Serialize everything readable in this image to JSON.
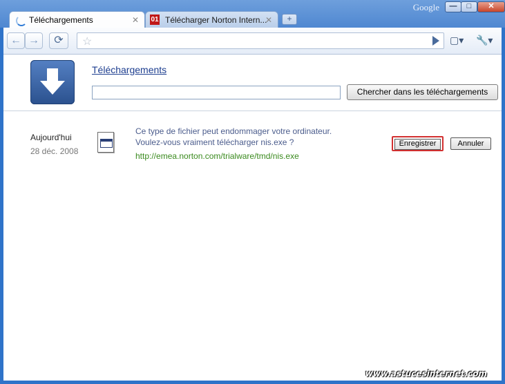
{
  "titlebar": {
    "brand": "Google"
  },
  "window_controls": {
    "minimize": "—",
    "maximize": "□",
    "close": "✕"
  },
  "tabs": [
    {
      "label": "Téléchargements",
      "active": true,
      "icon": "loading-spinner-icon"
    },
    {
      "label": "Télécharger Norton Intern...",
      "active": false,
      "icon": "01net-favicon"
    }
  ],
  "new_tab": "+",
  "toolbar": {
    "back": "←",
    "forward": "→",
    "reload": "⟳",
    "star": "☆",
    "address_value": "",
    "page_menu": "▢▾",
    "tools_menu": "🔧▾"
  },
  "downloads": {
    "page_title": "Téléchargements",
    "search_value": "",
    "search_button": "Chercher dans les téléchargements",
    "items": [
      {
        "day": "Aujourd'hui",
        "date": "28 déc. 2008",
        "warning_line1": "Ce type de fichier peut endommager votre ordinateur.",
        "warning_line2": "Voulez-vous vraiment télécharger nis.exe ?",
        "url": "http://emea.norton.com/trialware/tmd/nis.exe",
        "save_label": "Enregistrer",
        "cancel_label": "Annuler"
      }
    ]
  },
  "watermark": "www.astucesinternet.com",
  "colors": {
    "frame": "#2f73c9",
    "link": "#1c3d8f",
    "url": "#3a8a1e",
    "highlight": "#d23030"
  }
}
